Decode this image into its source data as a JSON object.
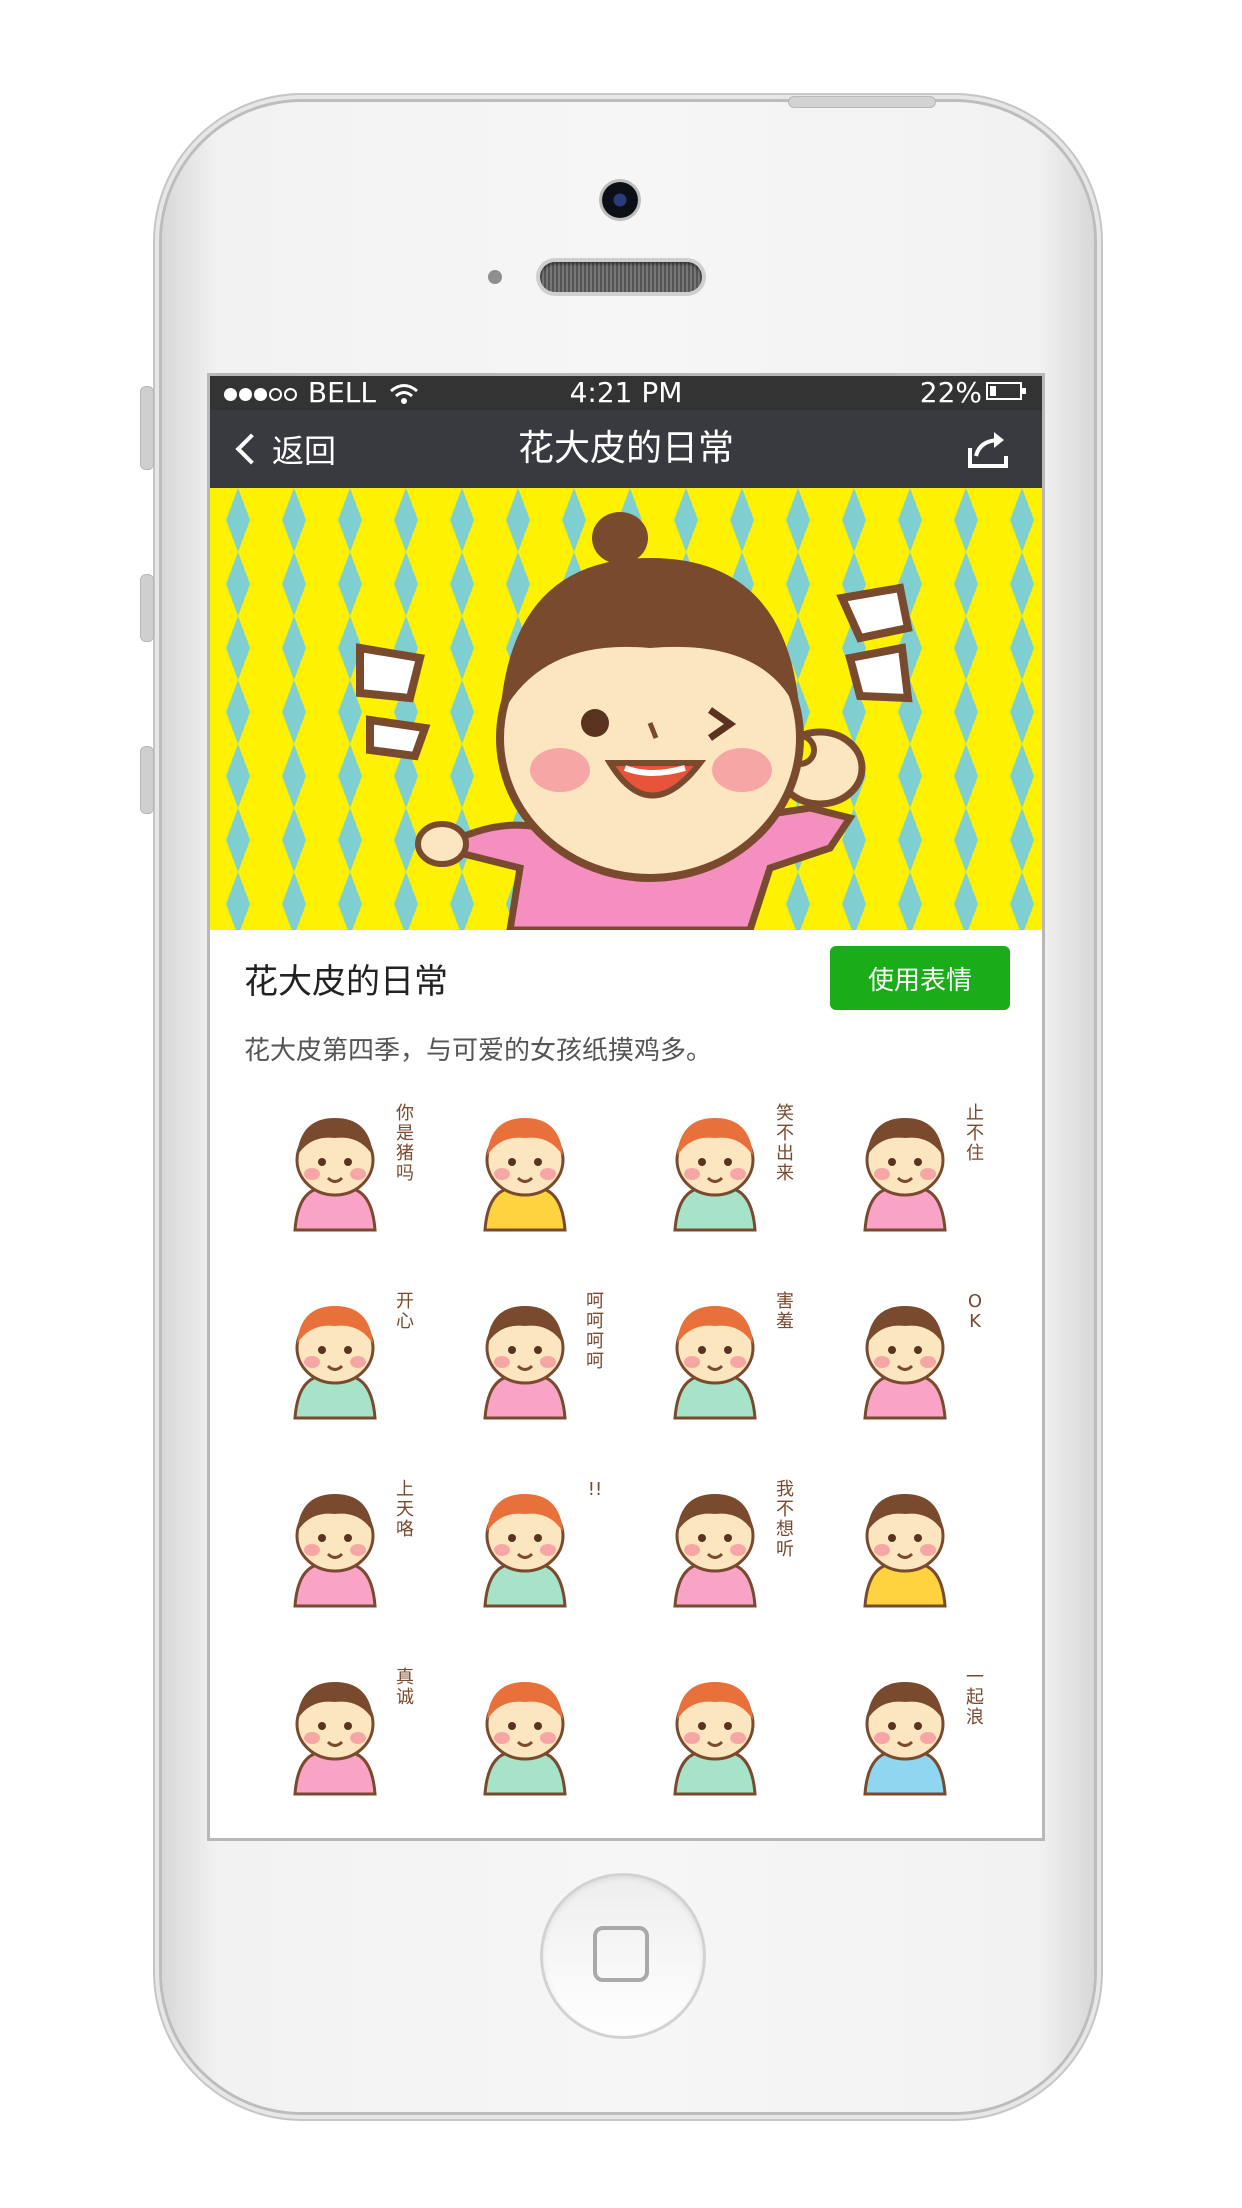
{
  "status": {
    "carrier": "BELL",
    "time": "4:21 PM",
    "battery": "22%",
    "signal_filled": 3,
    "signal_total": 5,
    "battery_level": 0.22
  },
  "nav": {
    "back_label": "返回",
    "title": "花大皮的日常"
  },
  "pack": {
    "title": "花大皮的日常",
    "use_button": "使用表情",
    "description": "花大皮第四季，与可爱的女孩纸摸鸡多。"
  },
  "stickers": [
    {
      "caption": "你是猪吗"
    },
    {
      "caption": ""
    },
    {
      "caption": "笑不出来"
    },
    {
      "caption": "止不住"
    },
    {
      "caption": "开心"
    },
    {
      "caption": "呵呵呵呵"
    },
    {
      "caption": "害羞"
    },
    {
      "caption": "OK"
    },
    {
      "caption": "上天咯"
    },
    {
      "caption": "!!"
    },
    {
      "caption": "我不想听"
    },
    {
      "caption": ""
    },
    {
      "caption": "真诚"
    },
    {
      "caption": ""
    },
    {
      "caption": ""
    },
    {
      "caption": "一起浪"
    }
  ],
  "colors": {
    "navbar": "#393a3f",
    "statusbar": "#333333",
    "accent_green": "#1aad19",
    "banner_yellow": "#fff200",
    "banner_diamond": "#7fcfd0"
  }
}
